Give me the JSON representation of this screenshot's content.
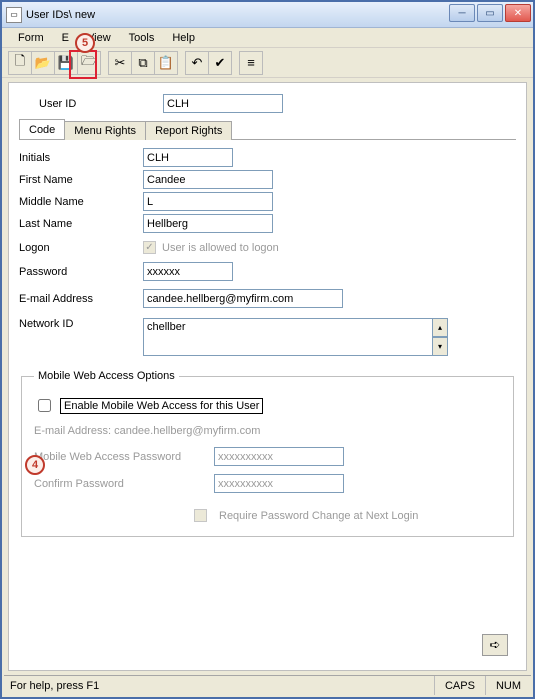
{
  "window": {
    "title": "User IDs\\ new"
  },
  "menus": {
    "form": "Form",
    "edit": "E",
    "view": "View",
    "tools": "Tools",
    "help": "Help"
  },
  "callouts": {
    "c4": "4",
    "c5": "5"
  },
  "header": {
    "userid_label": "User ID",
    "userid_value": "CLH"
  },
  "tabs": {
    "code": "Code",
    "menu_rights": "Menu Rights",
    "report_rights": "Report Rights"
  },
  "code": {
    "initials_label": "Initials",
    "initials_value": "CLH",
    "firstname_label": "First Name",
    "firstname_value": "Candee",
    "middlename_label": "Middle Name",
    "middlename_value": "L",
    "lastname_label": "Last Name",
    "lastname_value": "Hellberg",
    "logon_label": "Logon",
    "logon_text": "User is allowed to logon",
    "password_label": "Password",
    "password_value": "xxxxxx",
    "email_label": "E-mail Address",
    "email_value": "candee.hellberg@myfirm.com",
    "network_label": "Network ID",
    "network_value": "chellber"
  },
  "mwa": {
    "legend": "Mobile Web Access Options",
    "enable_label": "Enable Mobile Web Access for this User",
    "email_label": "E-mail Address:  candee.hellberg@myfirm.com",
    "password_label": "Mobile Web Access Password",
    "password_value": "xxxxxxxxxx",
    "confirm_label": "Confirm Password",
    "confirm_value": "xxxxxxxxxx",
    "require_label": "Require Password Change at Next Login"
  },
  "status": {
    "help": "For help, press F1",
    "caps": "CAPS",
    "num": "NUM"
  }
}
